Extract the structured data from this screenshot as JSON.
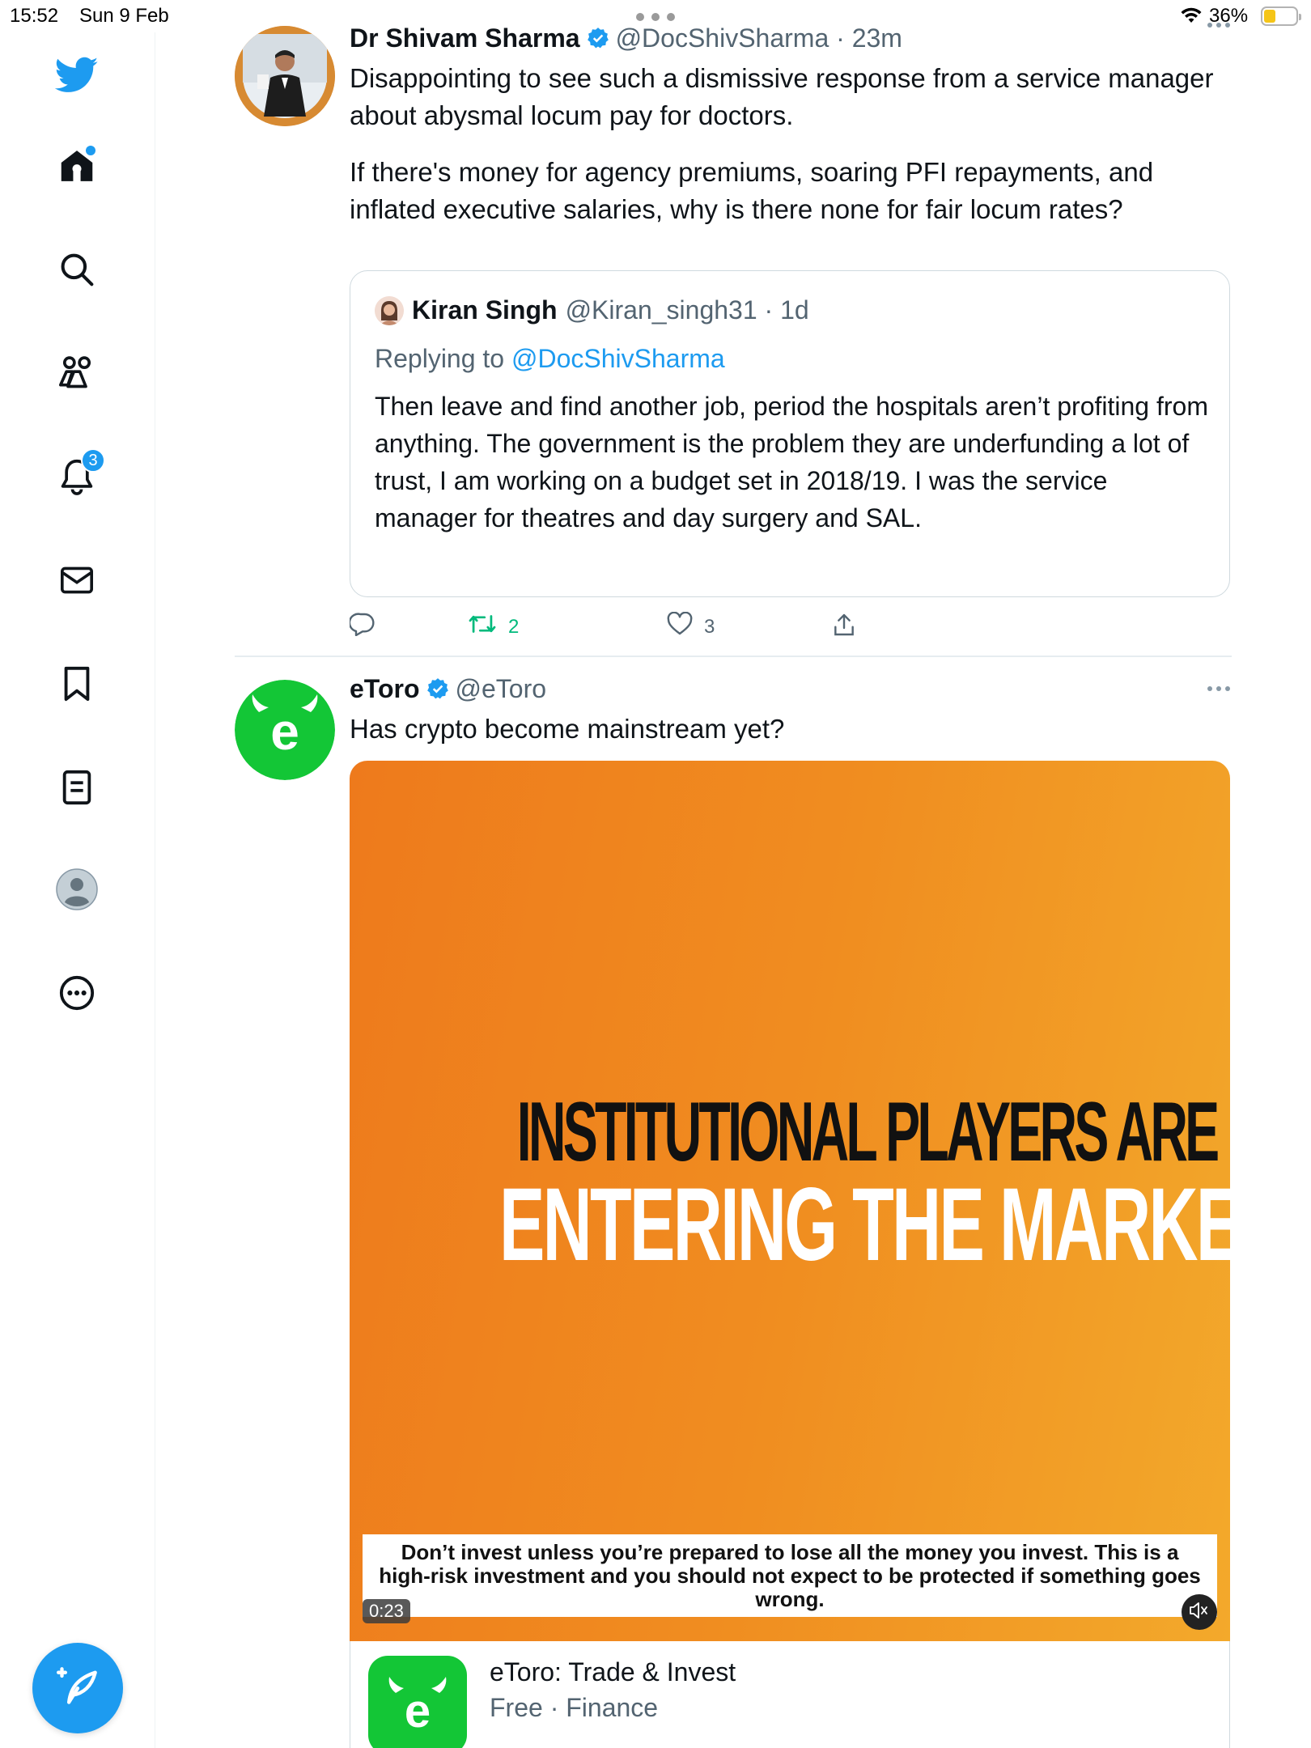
{
  "status_bar": {
    "time": "15:52",
    "date": "Sun 9 Feb",
    "battery": "36%",
    "battery_level": 0.36
  },
  "sidebar": {
    "items": [
      {
        "icon": "twitter-logo-icon"
      },
      {
        "icon": "home-icon",
        "has_dot": true
      },
      {
        "icon": "search-icon"
      },
      {
        "icon": "communities-icon"
      },
      {
        "icon": "notifications-icon",
        "badge": "3"
      },
      {
        "icon": "messages-icon"
      },
      {
        "icon": "bookmarks-icon"
      },
      {
        "icon": "lists-icon"
      },
      {
        "icon": "profile-icon"
      },
      {
        "icon": "more-icon"
      }
    ],
    "compose_icon": "compose-tweet-icon"
  },
  "tweets": [
    {
      "name": "Dr Shivam Sharma",
      "handle": "@DocShivSharma · 23m",
      "verified": true,
      "text_1": "Disappointing to see such a dismissive response from a service manager about abysmal locum pay for doctors.",
      "text_2": "If there's money for agency premiums, soaring PFI repayments, and inflated executive salaries, why is there none for fair locum rates?",
      "quote": {
        "name": "Kiran Singh",
        "handle": "@Kiran_singh31 · 1d",
        "replying_prefix": "Replying to",
        "replying_to": "@DocShivSharma",
        "text": "Then leave and find another job, period the hospitals aren’t profiting from anything. The government is the problem they are underfunding a lot of trust, I am working on a budget set in 2018/19. I was the service manager for theatres and day surgery and SAL."
      },
      "actions": {
        "replies": "",
        "retweets": "2",
        "likes": "3"
      }
    },
    {
      "name": "eToro",
      "handle": "@eToro",
      "verified": true,
      "text": "Has crypto become mainstream yet?",
      "media": {
        "headline_1": "INSTITUTIONAL PLAYERS ARE",
        "headline_2": "ENTERING THE MARKET",
        "disclaimer": "Don’t invest unless you’re prepared to lose all the money you invest. This is a high-risk investment and you should not expect to be protected if something goes wrong.",
        "duration": "0:23"
      },
      "app_card": {
        "title": "eToro: Trade & Invest",
        "subtitle": "Free · Finance"
      }
    }
  ],
  "colors": {
    "accent": "#1d9bf0",
    "retweet": "#00ba7c",
    "media_orange": "#f08d20",
    "etoro_green": "#13c636"
  }
}
